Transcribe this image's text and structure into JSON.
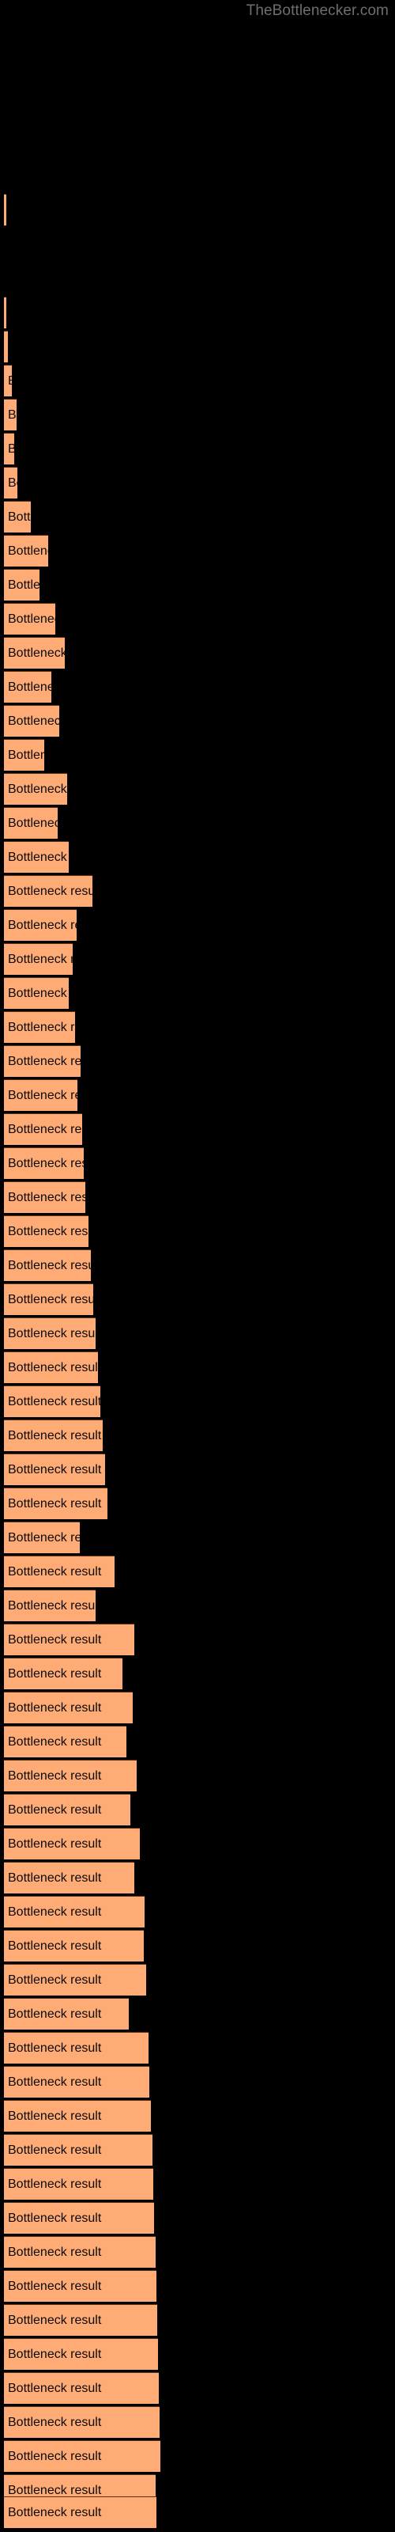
{
  "watermark": {
    "text": "TheBottlenecker.com",
    "color": "#6e6e6e"
  },
  "colors": {
    "background": "#000000",
    "bar_fill": "#ffab76",
    "bar_edge": "#5a2f12",
    "label_text": "#0a0a0a"
  },
  "chart_data": {
    "type": "bar",
    "orientation": "horizontal",
    "title": "",
    "subtitle": "",
    "xlabel": "",
    "ylabel": "",
    "grid": false,
    "legend": null,
    "background": "#000000",
    "bar_color": "#ffab76",
    "categories": [
      "Bottleneck result",
      "Bottleneck result",
      "Bottleneck result",
      "Bottleneck result",
      "Bottleneck result",
      "Bottleneck result",
      "Bottleneck result",
      "Bottleneck result",
      "Bottleneck result",
      "Bottleneck result",
      "Bottleneck result",
      "Bottleneck result",
      "Bottleneck result",
      "Bottleneck result",
      "Bottleneck result",
      "Bottleneck result",
      "Bottleneck result",
      "Bottleneck result",
      "Bottleneck result",
      "Bottleneck result",
      "Bottleneck result",
      "Bottleneck result",
      "Bottleneck result",
      "Bottleneck result",
      "Bottleneck result",
      "Bottleneck result",
      "Bottleneck result",
      "Bottleneck result",
      "Bottleneck result"
    ],
    "values": [
      3,
      3,
      5,
      9,
      10,
      13,
      35,
      55,
      45,
      65,
      75,
      60,
      70,
      50,
      80,
      68,
      82,
      112,
      92,
      87,
      82,
      90,
      97,
      93,
      99,
      101,
      103,
      107,
      193
    ],
    "xlim": [
      0,
      500
    ],
    "bar_labels": [
      {
        "y": 245,
        "width": 3,
        "text": "Bottleneck result"
      },
      {
        "y": 375,
        "width": 3,
        "text": "Bottleneck result"
      },
      {
        "y": 418,
        "width": 5,
        "text": "Bottleneck result"
      },
      {
        "y": 461,
        "width": 9,
        "text": "Bottleneck result"
      },
      {
        "y": 504,
        "width": 14,
        "text": "Bottleneck result"
      },
      {
        "y": 547,
        "width": 11,
        "text": "Bottleneck result"
      },
      {
        "y": 590,
        "width": 14,
        "text": "Bottleneck result"
      },
      {
        "y": 633,
        "width": 35,
        "text": "Bottleneck result"
      },
      {
        "y": 676,
        "width": 56,
        "text": "Bottleneck result"
      },
      {
        "y": 719,
        "width": 45,
        "text": "Bottleneck result"
      },
      {
        "y": 762,
        "width": 65,
        "text": "Bottleneck result"
      },
      {
        "y": 805,
        "width": 76,
        "text": "Bottleneck result"
      },
      {
        "y": 848,
        "width": 60,
        "text": "Bottleneck result"
      },
      {
        "y": 891,
        "width": 70,
        "text": "Bottleneck result"
      },
      {
        "y": 934,
        "width": 51,
        "text": "Bottleneck result"
      },
      {
        "y": 977,
        "width": 80,
        "text": "Bottleneck result"
      },
      {
        "y": 1020,
        "width": 68,
        "text": "Bottleneck result"
      },
      {
        "y": 1063,
        "width": 82,
        "text": "Bottleneck result"
      },
      {
        "y": 1106,
        "width": 112,
        "text": "Bottleneck result"
      },
      {
        "y": 1149,
        "width": 92,
        "text": "Bottleneck result"
      },
      {
        "y": 1192,
        "width": 87,
        "text": "Bottleneck result"
      },
      {
        "y": 1235,
        "width": 82,
        "text": "Bottleneck result"
      },
      {
        "y": 1278,
        "width": 90,
        "text": "Bottleneck result"
      },
      {
        "y": 1321,
        "width": 97,
        "text": "Bottleneck result"
      },
      {
        "y": 1364,
        "width": 93,
        "text": "Bottleneck result"
      },
      {
        "y": 1407,
        "width": 99,
        "text": "Bottleneck result"
      },
      {
        "y": 1450,
        "width": 101,
        "text": "Bottleneck result"
      },
      {
        "y": 1493,
        "width": 103,
        "text": "Bottleneck result"
      },
      {
        "y": 1536,
        "width": 107,
        "text": "Bottleneck result"
      }
    ]
  },
  "bars": [
    {
      "y": 245,
      "width": 3,
      "label": "Bottleneck result"
    },
    {
      "y": 375,
      "width": 3,
      "label": "Bottleneck result"
    },
    {
      "y": 418,
      "width": 5,
      "label": "Bottleneck result"
    },
    {
      "y": 461,
      "width": 10,
      "label": "Bottleneck result"
    },
    {
      "y": 504,
      "width": 16,
      "label": "Bottleneck result"
    },
    {
      "y": 547,
      "width": 13,
      "label": "Bottleneck result"
    },
    {
      "y": 590,
      "width": 17,
      "label": "Bottleneck result"
    },
    {
      "y": 633,
      "width": 34,
      "label": "Bottleneck result"
    },
    {
      "y": 676,
      "width": 56,
      "label": "Bottleneck result"
    },
    {
      "y": 719,
      "width": 45,
      "label": "Bottleneck result"
    },
    {
      "y": 762,
      "width": 65,
      "label": "Bottleneck result"
    },
    {
      "y": 805,
      "width": 77,
      "label": "Bottleneck result"
    },
    {
      "y": 848,
      "width": 60,
      "label": "Bottleneck result"
    },
    {
      "y": 891,
      "width": 70,
      "label": "Bottleneck result"
    },
    {
      "y": 934,
      "width": 51,
      "label": "Bottleneck result"
    },
    {
      "y": 977,
      "width": 80,
      "label": "Bottleneck result"
    },
    {
      "y": 1020,
      "width": 68,
      "label": "Bottleneck result"
    },
    {
      "y": 1063,
      "width": 82,
      "label": "Bottleneck result"
    },
    {
      "y": 1106,
      "width": 112,
      "label": "Bottleneck result"
    },
    {
      "y": 1149,
      "width": 92,
      "label": "Bottleneck result"
    },
    {
      "y": 1192,
      "width": 87,
      "label": "Bottleneck result"
    },
    {
      "y": 1235,
      "width": 82,
      "label": "Bottleneck result"
    },
    {
      "y": 1278,
      "width": 90,
      "label": "Bottleneck result"
    },
    {
      "y": 1321,
      "width": 97,
      "label": "Bottleneck result"
    },
    {
      "y": 1364,
      "width": 93,
      "label": "Bottleneck result"
    },
    {
      "y": 1407,
      "width": 99,
      "label": "Bottleneck result"
    },
    {
      "y": 1450,
      "width": 101,
      "label": "Bottleneck result"
    },
    {
      "y": 1493,
      "width": 103,
      "label": "Bottleneck result"
    },
    {
      "y": 1536,
      "width": 107,
      "label": "Bottleneck result"
    },
    {
      "y": 1579,
      "width": 110,
      "label": "Bottleneck result"
    },
    {
      "y": 1622,
      "width": 113,
      "label": "Bottleneck result"
    },
    {
      "y": 1665,
      "width": 116,
      "label": "Bottleneck result"
    },
    {
      "y": 1708,
      "width": 119,
      "label": "Bottleneck result"
    },
    {
      "y": 1751,
      "width": 122,
      "label": "Bottleneck result"
    },
    {
      "y": 1794,
      "width": 125,
      "label": "Bottleneck result"
    },
    {
      "y": 1837,
      "width": 128,
      "label": "Bottleneck result"
    },
    {
      "y": 1880,
      "width": 131,
      "label": "Bottleneck result"
    },
    {
      "y": 1923,
      "width": 96,
      "label": "Bottleneck result"
    },
    {
      "y": 1966,
      "width": 140,
      "label": "Bottleneck result"
    },
    {
      "y": 2009,
      "width": 116,
      "label": "Bottleneck result"
    },
    {
      "y": 2052,
      "width": 165,
      "label": "Bottleneck result"
    },
    {
      "y": 2095,
      "width": 150,
      "label": "Bottleneck result"
    },
    {
      "y": 2138,
      "width": 163,
      "label": "Bottleneck result"
    },
    {
      "y": 2181,
      "width": 155,
      "label": "Bottleneck result"
    },
    {
      "y": 2224,
      "width": 168,
      "label": "Bottleneck result"
    },
    {
      "y": 2267,
      "width": 160,
      "label": "Bottleneck result"
    },
    {
      "y": 2310,
      "width": 172,
      "label": "Bottleneck result"
    },
    {
      "y": 2353,
      "width": 165,
      "label": "Bottleneck result"
    },
    {
      "y": 2396,
      "width": 178,
      "label": "Bottleneck result"
    },
    {
      "y": 2439,
      "width": 177,
      "label": "Bottleneck result"
    },
    {
      "y": 2482,
      "width": 180,
      "label": "Bottleneck result"
    },
    {
      "y": 2525,
      "width": 158,
      "label": "Bottleneck result"
    },
    {
      "y": 2568,
      "width": 183,
      "label": "Bottleneck result"
    },
    {
      "y": 2611,
      "width": 184,
      "label": "Bottleneck result"
    },
    {
      "y": 2654,
      "width": 186,
      "label": "Bottleneck result"
    },
    {
      "y": 2697,
      "width": 188,
      "label": "Bottleneck result"
    },
    {
      "y": 2740,
      "width": 189,
      "label": "Bottleneck result"
    },
    {
      "y": 2783,
      "width": 190,
      "label": "Bottleneck result"
    },
    {
      "y": 2826,
      "width": 192,
      "label": "Bottleneck result"
    },
    {
      "y": 2869,
      "width": 193,
      "label": "Bottleneck result"
    },
    {
      "y": 2912,
      "width": 194,
      "label": "Bottleneck result"
    },
    {
      "y": 2955,
      "width": 195,
      "label": "Bottleneck result"
    },
    {
      "y": 2998,
      "width": 196,
      "label": "Bottleneck result"
    },
    {
      "y": 3041,
      "width": 197,
      "label": "Bottleneck result"
    },
    {
      "y": 3084,
      "width": 198,
      "label": "Bottleneck result"
    },
    {
      "y": 3127,
      "width": 192,
      "label": "Bottleneck result"
    },
    {
      "y": 3155,
      "width": 193,
      "label": "Bottleneck result"
    }
  ]
}
